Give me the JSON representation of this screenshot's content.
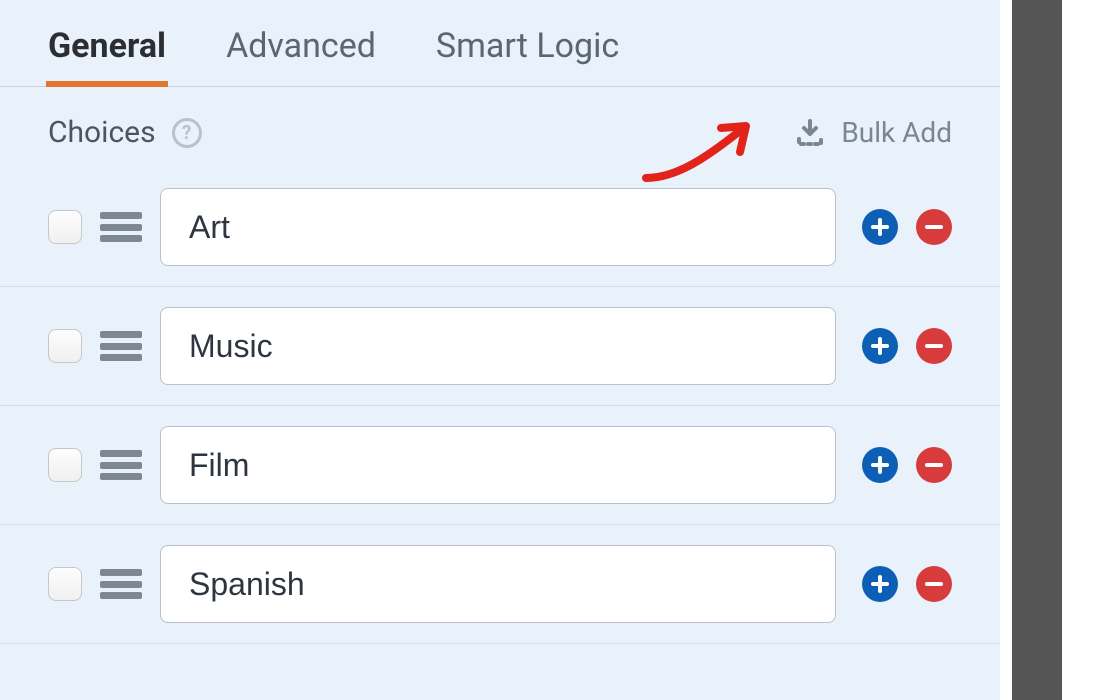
{
  "tabs": {
    "general": "General",
    "advanced": "Advanced",
    "smart_logic": "Smart Logic"
  },
  "section": {
    "title": "Choices",
    "bulk_add": "Bulk Add"
  },
  "choices": [
    {
      "value": "Art"
    },
    {
      "value": "Music"
    },
    {
      "value": "Film"
    },
    {
      "value": "Spanish"
    }
  ]
}
